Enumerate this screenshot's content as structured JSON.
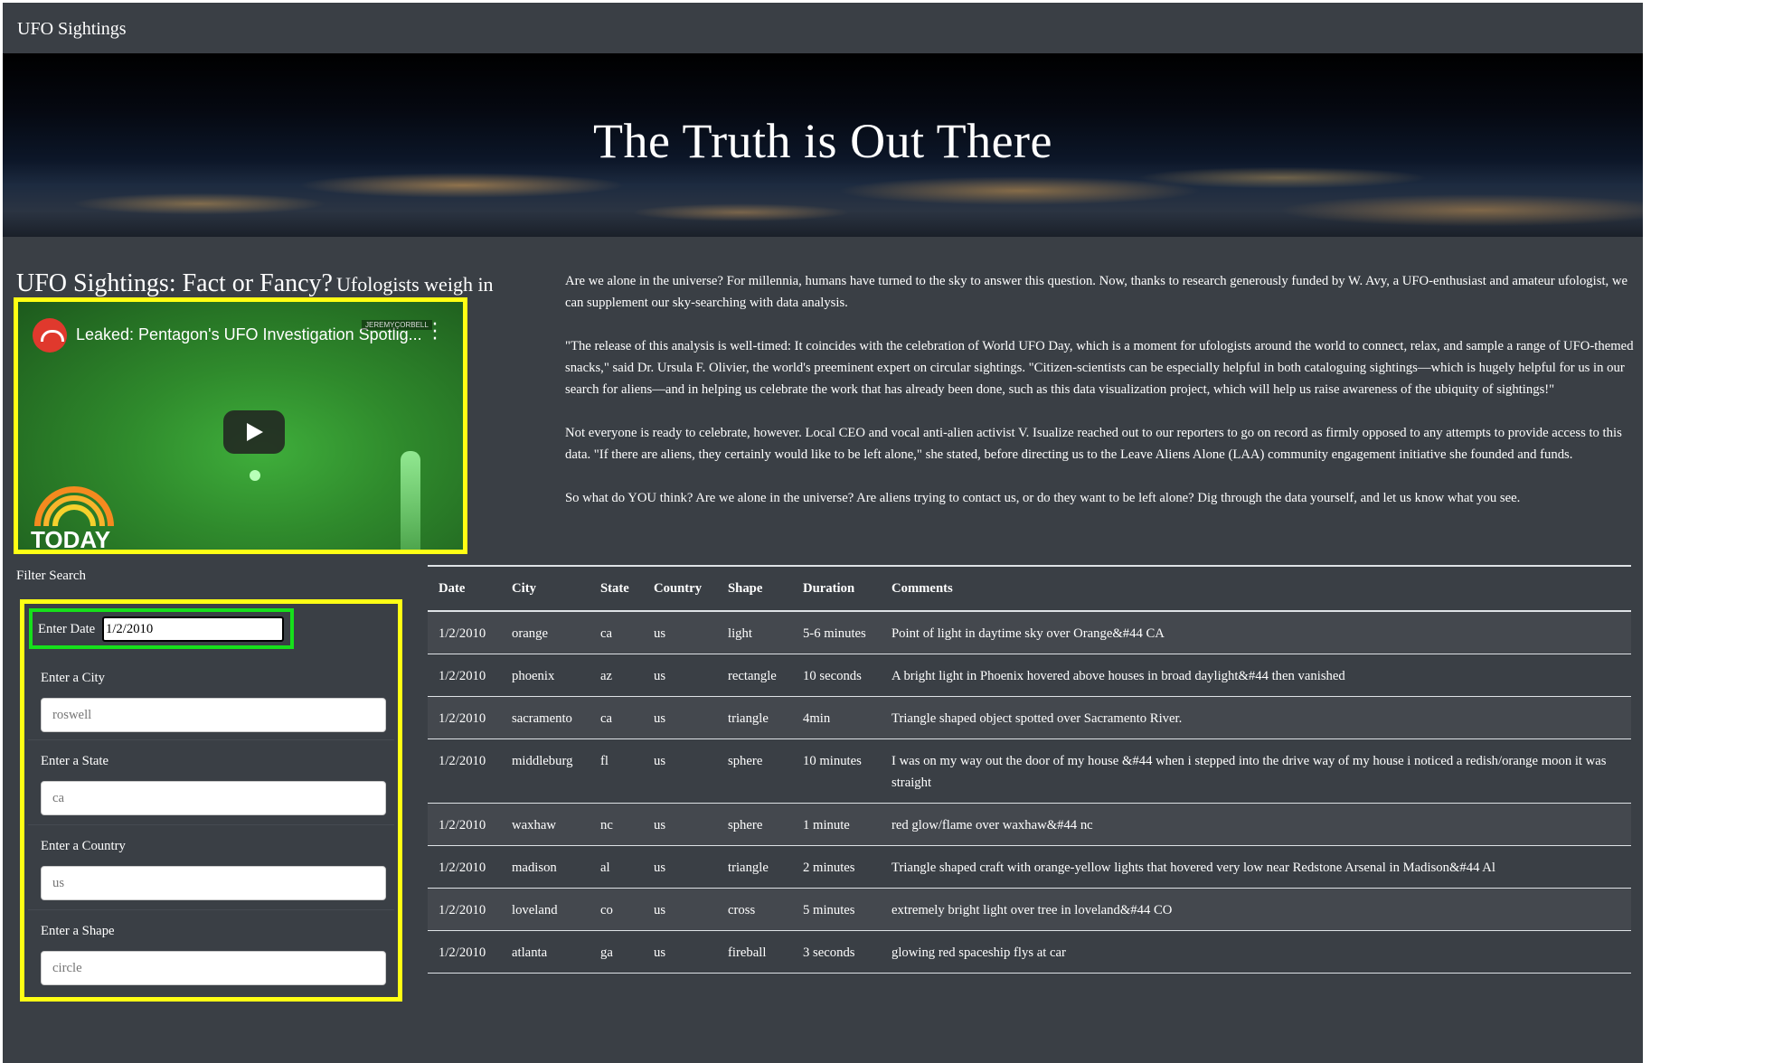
{
  "nav": {
    "brand": "UFO Sightings"
  },
  "banner": {
    "title": "The Truth is Out There"
  },
  "video": {
    "heading_main": "UFO Sightings: Fact or Fancy?",
    "heading_sub": "Ufologists weigh in",
    "title": "Leaked: Pentagon's UFO Investigation Spotlig...",
    "watermark": "JEREMYCORBELL",
    "logo_text": "TODAY"
  },
  "article": {
    "paragraphs": [
      "Are we alone in the universe? For millennia, humans have turned to the sky to answer this question. Now, thanks to research generously funded by W. Avy, a UFO-enthusiast and amateur ufologist, we can supplement our sky-searching with data analysis.",
      "\"The release of this analysis is well-timed: It coincides with the celebration of World UFO Day, which is a moment for ufologists around the world to connect, relax, and sample a range of UFO-themed snacks,\" said Dr. Ursula F. Olivier, the world's preeminent expert on circular sightings. \"Citizen-scientists can be especially helpful in both cataloguing sightings—which is hugely helpful for us in our search for aliens—and in helping us celebrate the work that has already been done, such as this data visualization project, which will help us raise awareness of the ubiquity of sightings!\"",
      "Not everyone is ready to celebrate, however. Local CEO and vocal anti-alien activist V. Isualize reached out to our reporters to go on record as firmly opposed to any attempts to provide access to this data. \"If there are aliens, they certainly would like to be left alone,\" she stated, before directing us to the Leave Aliens Alone (LAA) community engagement initiative she founded and funds.",
      "So what do YOU think? Are we alone in the universe? Are aliens trying to contact us, or do they want to be left alone? Dig through the data yourself, and let us know what you see."
    ]
  },
  "filters": {
    "title": "Filter Search",
    "date": {
      "label": "Enter Date",
      "value": "1/2/2010"
    },
    "city": {
      "label": "Enter a City",
      "placeholder": "roswell"
    },
    "state": {
      "label": "Enter a State",
      "placeholder": "ca"
    },
    "country": {
      "label": "Enter a Country",
      "placeholder": "us"
    },
    "shape": {
      "label": "Enter a Shape",
      "placeholder": "circle"
    }
  },
  "table": {
    "headers": [
      "Date",
      "City",
      "State",
      "Country",
      "Shape",
      "Duration",
      "Comments"
    ],
    "rows": [
      [
        "1/2/2010",
        "orange",
        "ca",
        "us",
        "light",
        "5-6 minutes",
        "Point of light in daytime sky over Orange&#44 CA"
      ],
      [
        "1/2/2010",
        "phoenix",
        "az",
        "us",
        "rectangle",
        "10 seconds",
        "A bright light in Phoenix hovered above houses in broad daylight&#44 then vanished"
      ],
      [
        "1/2/2010",
        "sacramento",
        "ca",
        "us",
        "triangle",
        "4min",
        "Triangle shaped object spotted over Sacramento River."
      ],
      [
        "1/2/2010",
        "middleburg",
        "fl",
        "us",
        "sphere",
        "10 minutes",
        "I was on my way out the door of my house &#44 when i stepped into the drive way of my house i noticed a redish/orange moon it was straight"
      ],
      [
        "1/2/2010",
        "waxhaw",
        "nc",
        "us",
        "sphere",
        "1 minute",
        "red glow/flame over waxhaw&#44 nc"
      ],
      [
        "1/2/2010",
        "madison",
        "al",
        "us",
        "triangle",
        "2 minutes",
        "Triangle shaped craft with orange-yellow lights that hovered very low near Redstone Arsenal in Madison&#44 Al"
      ],
      [
        "1/2/2010",
        "loveland",
        "co",
        "us",
        "cross",
        "5 minutes",
        "extremely bright light over tree in loveland&#44 CO"
      ],
      [
        "1/2/2010",
        "atlanta",
        "ga",
        "us",
        "fireball",
        "3 seconds",
        "glowing red spaceship flys at car"
      ]
    ]
  },
  "colors": {
    "page_bg": "#3a3f45",
    "highlight_yellow": "#ffff14",
    "highlight_green": "#16e01b"
  }
}
